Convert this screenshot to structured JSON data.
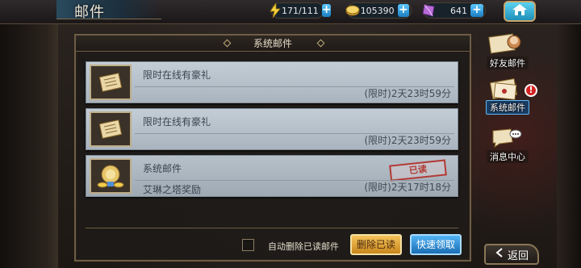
{
  "header": {
    "title": "邮件",
    "resources": [
      {
        "name": "stamina",
        "icon": "lightning-icon",
        "value": "171/111"
      },
      {
        "name": "gold",
        "icon": "coin-icon",
        "value": "105390"
      },
      {
        "name": "gem",
        "icon": "gem-icon",
        "value": "641"
      }
    ],
    "plus_symbol": "+"
  },
  "panel": {
    "title": "系统邮件"
  },
  "mails": [
    {
      "title": "限时在线有豪礼",
      "subtitle": "",
      "time": "(限时)2天23时59分",
      "icon": "scroll-icon",
      "read": false
    },
    {
      "title": "限时在线有豪礼",
      "subtitle": "",
      "time": "(限时)2天23时59分",
      "icon": "scroll-icon",
      "read": false
    },
    {
      "title": "系统邮件",
      "subtitle": "艾琳之塔奖励",
      "time": "(限时)2天17时18分",
      "icon": "treasure-icon",
      "read": true,
      "stamp": "已读"
    }
  ],
  "footer": {
    "auto_delete_label": "自动删除已读邮件",
    "delete_read_button": "删除已读",
    "quick_claim_button": "快速领取"
  },
  "side_menu": [
    {
      "label": "好友邮件",
      "icon": "friend-mail-icon",
      "active": false
    },
    {
      "label": "系统邮件",
      "icon": "system-mail-icon",
      "active": true,
      "badge": "!"
    },
    {
      "label": "消息中心",
      "icon": "message-bubble-icon",
      "active": false
    }
  ],
  "back_button": "返回",
  "colors": {
    "accent_blue": "#1f8fb8",
    "button_gold": "#f4c35a",
    "stamp_red": "#b23a34"
  }
}
